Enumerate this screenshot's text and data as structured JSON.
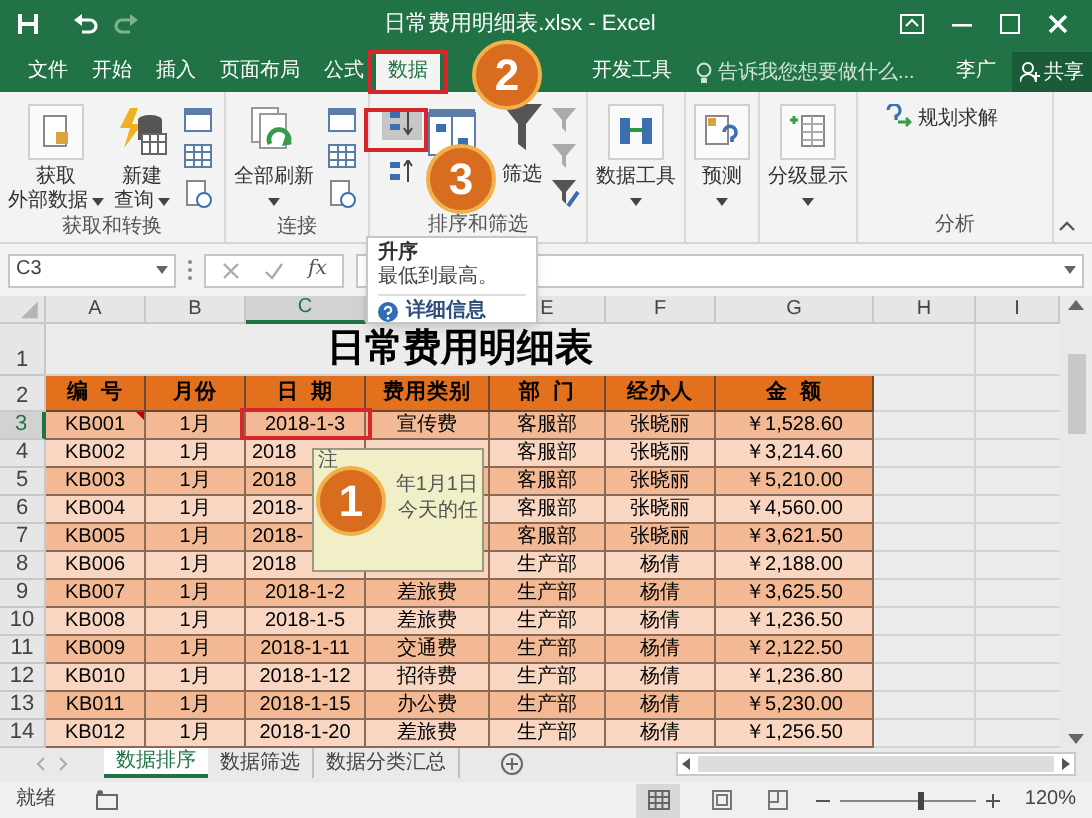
{
  "window": {
    "title": "日常费用明细表.xlsx - Excel"
  },
  "ribbon_tabs": [
    {
      "label": "文件",
      "selected": false
    },
    {
      "label": "开始",
      "selected": false
    },
    {
      "label": "插入",
      "selected": false
    },
    {
      "label": "页面布局",
      "selected": false
    },
    {
      "label": "公式",
      "selected": false
    },
    {
      "label": "数据",
      "selected": true
    },
    {
      "label": "开发工具",
      "selected": false
    }
  ],
  "tell_me": {
    "placeholder": "告诉我您想要做什么..."
  },
  "user": {
    "name": "李广"
  },
  "share_button": {
    "label": "共享"
  },
  "ribbon_groups": [
    {
      "label": "获取和转换",
      "items": [
        {
          "kind": "large",
          "lines": [
            "获取",
            "外部数据"
          ],
          "dropdown": true
        },
        {
          "kind": "large",
          "lines": [
            "新建",
            "查询"
          ],
          "dropdown": true
        },
        {
          "kind": "small-stack"
        }
      ]
    },
    {
      "label": "连接",
      "items": [
        {
          "kind": "large",
          "lines": [
            "全部刷新"
          ],
          "dropdown": true
        },
        {
          "kind": "small-stack"
        }
      ]
    },
    {
      "label": "排序和筛选",
      "items": [
        {
          "kind": "sort-stack",
          "buttons": [
            {
              "pressed": true
            },
            {
              "pressed": false
            }
          ]
        },
        {
          "kind": "sort-dialog"
        },
        {
          "kind": "filter",
          "lines": [
            "筛选"
          ]
        },
        {
          "kind": "filter-stack"
        }
      ]
    },
    {
      "items": [
        {
          "kind": "large",
          "lines": [
            "数据工具"
          ],
          "dropdown": true
        }
      ]
    },
    {
      "items": [
        {
          "kind": "large",
          "lines": [
            "预测"
          ],
          "dropdown": true
        }
      ]
    },
    {
      "items": [
        {
          "kind": "large",
          "lines": [
            "分级显示"
          ],
          "dropdown": true
        }
      ]
    },
    {
      "label": "分析",
      "items": [
        {
          "kind": "small-labeled",
          "lines": [
            "规划求解"
          ]
        }
      ]
    }
  ],
  "sort_tooltip": {
    "title": "升序",
    "description": "最低到最高。",
    "link": "详细信息"
  },
  "formula_bar": {
    "name_box": "C3",
    "function_button": "fx"
  },
  "sheet": {
    "columns": [
      {
        "label": "A",
        "selected": false
      },
      {
        "label": "B",
        "selected": false
      },
      {
        "label": "C",
        "selected": true
      },
      null,
      {
        "label": "E",
        "selected": false
      },
      {
        "label": "F",
        "selected": false
      },
      {
        "label": "G",
        "selected": false
      },
      {
        "label": "H",
        "selected": false
      },
      {
        "label": "I",
        "selected": false
      }
    ],
    "title_row": {
      "number": "1",
      "selected": false,
      "text": "日常费用明细表"
    },
    "header_row": {
      "number": "2",
      "selected": false,
      "cells": [
        "编  号",
        "月份",
        "日  期",
        "费用类别",
        "部  门",
        "经办人",
        "金  额"
      ]
    },
    "rows": [
      {
        "number": "3",
        "selected": true,
        "covered": false,
        "cells": [
          "KB001",
          "1月",
          "2018-1-3",
          "宣传费",
          "客服部",
          "张晓丽",
          "￥1,528.60"
        ]
      },
      {
        "number": "4",
        "selected": false,
        "covered": true,
        "cells": [
          "KB002",
          "1月",
          "2018",
          null,
          "客服部",
          "张晓丽",
          "￥3,214.60"
        ]
      },
      {
        "number": "5",
        "selected": false,
        "covered": true,
        "cells": [
          "KB003",
          "1月",
          "2018",
          null,
          "客服部",
          "张晓丽",
          "￥5,210.00"
        ]
      },
      {
        "number": "6",
        "selected": false,
        "covered": true,
        "cells": [
          "KB004",
          "1月",
          "2018-",
          null,
          "客服部",
          "张晓丽",
          "￥4,560.00"
        ]
      },
      {
        "number": "7",
        "selected": false,
        "covered": true,
        "cells": [
          "KB005",
          "1月",
          "2018-",
          null,
          "客服部",
          "张晓丽",
          "￥3,621.50"
        ]
      },
      {
        "number": "8",
        "selected": false,
        "covered": true,
        "cells": [
          "KB006",
          "1月",
          "2018",
          null,
          "生产部",
          "杨倩",
          "￥2,188.00"
        ]
      },
      {
        "number": "9",
        "selected": false,
        "covered": false,
        "cells": [
          "KB007",
          "1月",
          "2018-1-2",
          "差旅费",
          "生产部",
          "杨倩",
          "￥3,625.50"
        ]
      },
      {
        "number": "10",
        "selected": false,
        "covered": false,
        "cells": [
          "KB008",
          "1月",
          "2018-1-5",
          "差旅费",
          "生产部",
          "杨倩",
          "￥1,236.50"
        ]
      },
      {
        "number": "11",
        "selected": false,
        "covered": false,
        "cells": [
          "KB009",
          "1月",
          "2018-1-11",
          "交通费",
          "生产部",
          "杨倩",
          "￥2,122.50"
        ]
      },
      {
        "number": "12",
        "selected": false,
        "covered": false,
        "cells": [
          "KB010",
          "1月",
          "2018-1-12",
          "招待费",
          "生产部",
          "杨倩",
          "￥1,236.80"
        ]
      },
      {
        "number": "13",
        "selected": false,
        "covered": false,
        "cells": [
          "KB011",
          "1月",
          "2018-1-15",
          "办公费",
          "生产部",
          "杨倩",
          "￥5,230.00"
        ]
      },
      {
        "number": "14",
        "selected": false,
        "covered": false,
        "cells": [
          "KB012",
          "1月",
          "2018-1-20",
          "差旅费",
          "生产部",
          "杨倩",
          "￥1,256.50"
        ]
      }
    ],
    "comment": {
      "texts": [
        "注",
        "年1月1日",
        "今天的任"
      ]
    }
  },
  "sheet_tabs": [
    {
      "label": "数据排序",
      "selected": true
    },
    {
      "label": "数据筛选",
      "selected": false
    },
    {
      "label": "数据分类汇总",
      "selected": false
    }
  ],
  "status_bar": {
    "text": "就绪",
    "zoom": {
      "level": 0.6,
      "reading": "120%"
    }
  },
  "callouts": [
    {
      "label": "2"
    },
    {
      "label": "3"
    },
    {
      "label": "1"
    }
  ]
}
